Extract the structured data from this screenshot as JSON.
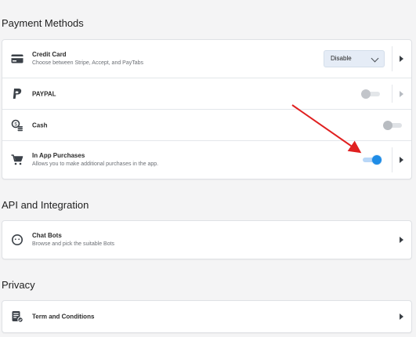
{
  "sections": {
    "payment": {
      "title": "Payment Methods",
      "items": [
        {
          "title": "Credit Card",
          "desc": "Choose between Stripe, Accept, and PayTabs",
          "select_value": "Disable"
        },
        {
          "title": "PAYPAL"
        },
        {
          "title": "Cash"
        },
        {
          "title": "In App Purchases",
          "desc": "Allows you to make additional purchases in the app."
        }
      ]
    },
    "api": {
      "title": "API and Integration",
      "items": [
        {
          "title": "Chat Bots",
          "desc": "Browse and pick the suitable Bots"
        }
      ]
    },
    "privacy": {
      "title": "Privacy",
      "items": [
        {
          "title": "Term and Conditions"
        }
      ]
    }
  },
  "toggles": {
    "paypal": "off",
    "cash": "off",
    "in_app_purchases": "on"
  },
  "icons": {
    "credit_card": "credit-card-icon",
    "paypal": "paypal-icon",
    "cash": "cash-icon",
    "in_app": "cart-icon",
    "chat_bots": "bot-icon",
    "terms": "document-check-icon"
  },
  "colors": {
    "accent": "#1f8ce6",
    "annotation_arrow": "#e02020"
  }
}
